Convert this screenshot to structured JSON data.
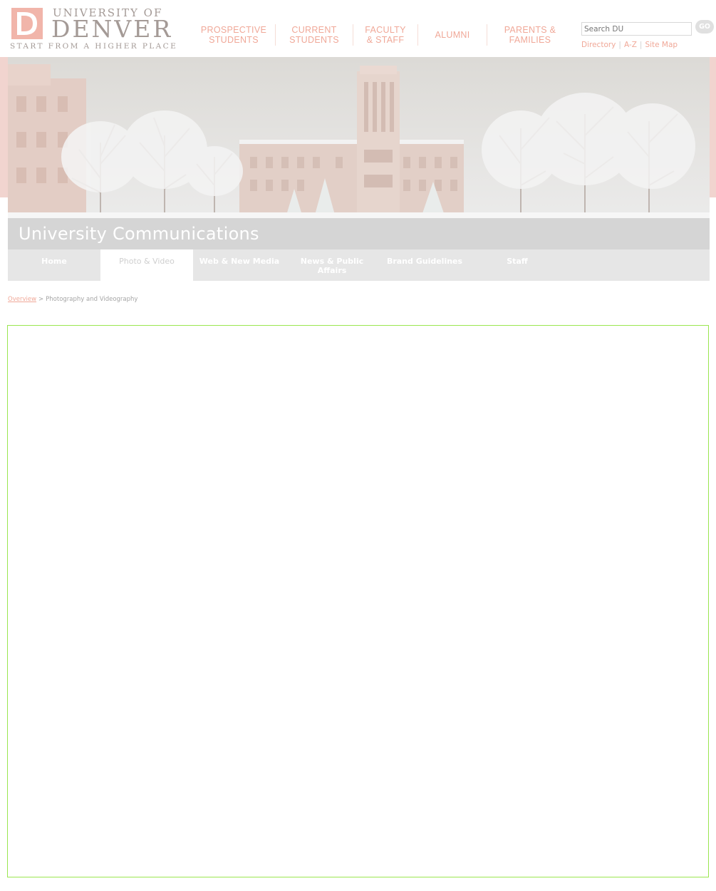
{
  "header": {
    "logo": {
      "line1": "UNIVERSITY OF",
      "line2": "DENVER",
      "tagline": "START FROM A HIGHER PLACE",
      "color": "#a49a96",
      "mark_color": "#f1b5aa"
    },
    "nav": [
      {
        "line1": "PROSPECTIVE",
        "line2": "STUDENTS"
      },
      {
        "line1": "CURRENT",
        "line2": "STUDENTS"
      },
      {
        "line1": "FACULTY",
        "line2": "& STAFF"
      },
      {
        "line1": "ALUMNI",
        "line2": ""
      },
      {
        "line1": "PARENTS &",
        "line2": "FAMILIES"
      }
    ],
    "search": {
      "placeholder": "Search DU",
      "button": "GO"
    },
    "utility_links": [
      "Directory",
      "A-Z",
      "Site Map"
    ],
    "accent_color": "#f0a898"
  },
  "banner": {
    "title": "University Communications",
    "image": "snowy-campus-tower-photo"
  },
  "subnav": {
    "tabs": [
      "Home",
      "Photo & Video",
      "Web & New Media",
      "News & Public Affairs",
      "Brand Guidelines",
      "Staff"
    ],
    "active": "Photo & Video"
  },
  "breadcrumb": {
    "link": "Overview",
    "separator": ">",
    "current": "Photography and Videography"
  },
  "content": {
    "frame_border_color": "#9ae64f"
  }
}
